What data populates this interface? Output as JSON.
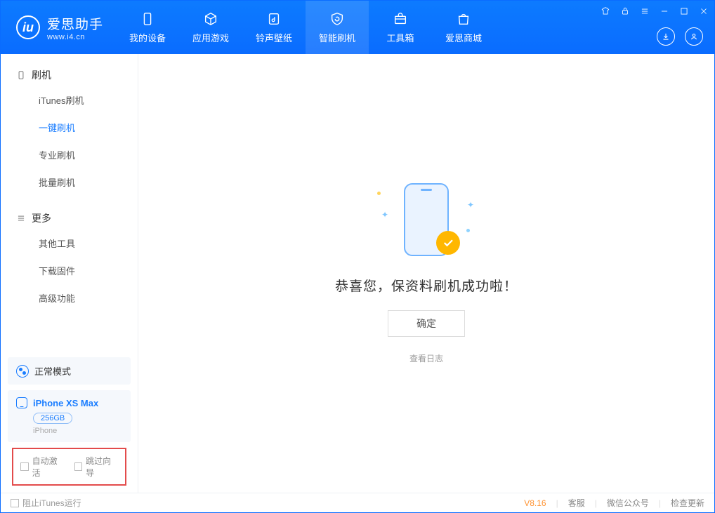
{
  "app": {
    "name": "爱思助手",
    "url": "www.i4.cn"
  },
  "nav": {
    "items": [
      {
        "label": "我的设备"
      },
      {
        "label": "应用游戏"
      },
      {
        "label": "铃声壁纸"
      },
      {
        "label": "智能刷机"
      },
      {
        "label": "工具箱"
      },
      {
        "label": "爱思商城"
      }
    ]
  },
  "sidebar": {
    "group_flash": "刷机",
    "flash_items": [
      {
        "label": "iTunes刷机"
      },
      {
        "label": "一键刷机"
      },
      {
        "label": "专业刷机"
      },
      {
        "label": "批量刷机"
      }
    ],
    "group_more": "更多",
    "more_items": [
      {
        "label": "其他工具"
      },
      {
        "label": "下载固件"
      },
      {
        "label": "高级功能"
      }
    ],
    "mode_label": "正常模式",
    "device": {
      "name": "iPhone XS Max",
      "capacity": "256GB",
      "type": "iPhone"
    },
    "cb_auto_activate": "自动激活",
    "cb_skip_guide": "跳过向导"
  },
  "content": {
    "success_text": "恭喜您，保资料刷机成功啦！",
    "ok_label": "确定",
    "log_link": "查看日志"
  },
  "footer": {
    "block_itunes": "阻止iTunes运行",
    "version": "V8.16",
    "support": "客服",
    "wechat": "微信公众号",
    "check_update": "检查更新"
  }
}
